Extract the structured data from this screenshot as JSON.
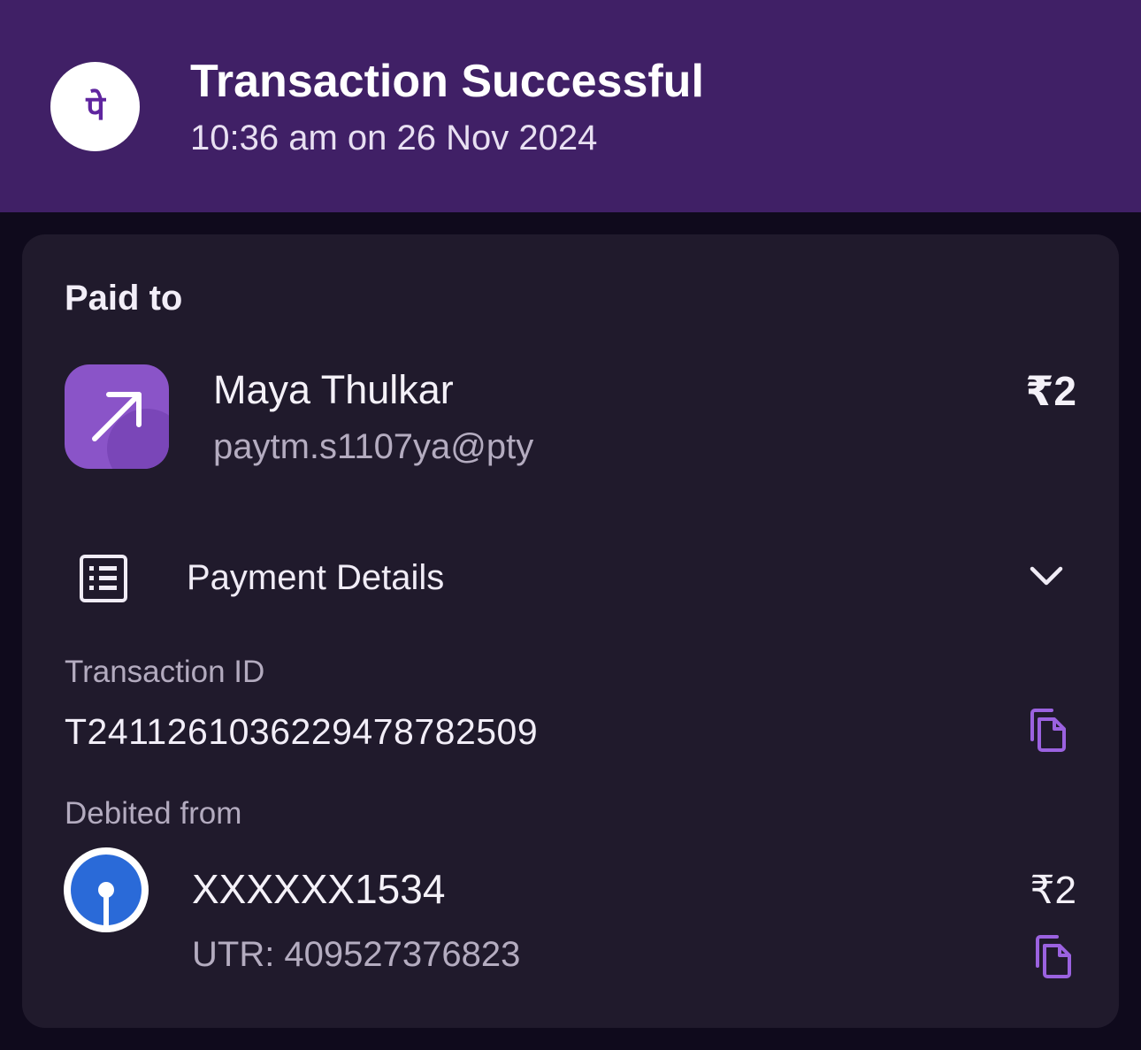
{
  "header": {
    "title": "Transaction Successful",
    "timestamp": "10:36 am on 26 Nov 2024",
    "logo_icon": "phonepe-logo-icon",
    "logo_glyph": "पे"
  },
  "paid_to": {
    "label": "Paid to",
    "name": "Maya Thulkar",
    "upi_id": "paytm.s1107ya@pty",
    "amount": "₹2",
    "icon": "arrow-up-right-icon"
  },
  "payment_details": {
    "label": "Payment Details",
    "icon": "receipt-list-icon",
    "chevron_icon": "chevron-down-icon"
  },
  "transaction": {
    "id_label": "Transaction ID",
    "id_value": "T2411261036229478782509",
    "copy_icon": "copy-icon"
  },
  "debited": {
    "label": "Debited from",
    "account": "XXXXXX1534",
    "utr": "UTR: 409527376823",
    "amount": "₹2",
    "bank_icon": "sbi-bank-logo-icon",
    "copy_icon": "copy-icon"
  },
  "colors": {
    "header_bg": "#402066",
    "page_bg": "#0f0a1c",
    "card_bg": "#201a2c",
    "accent": "#8a54c8"
  }
}
